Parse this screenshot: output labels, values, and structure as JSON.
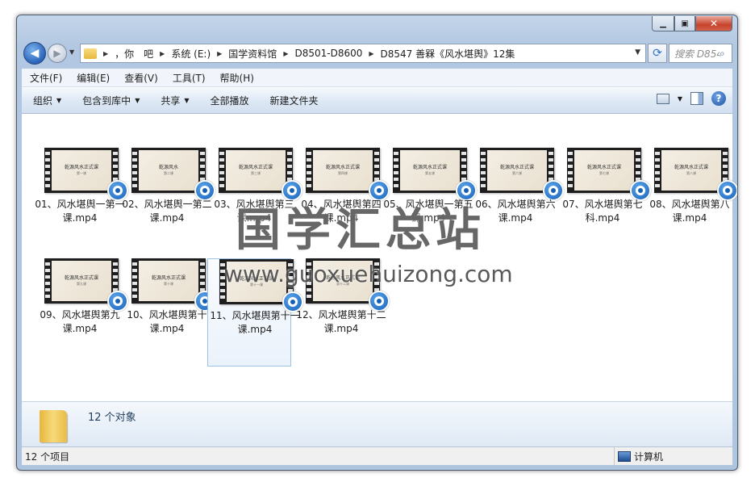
{
  "window": {
    "min_label": "▁",
    "max_label": "▣",
    "close_label": "✕"
  },
  "nav": {
    "back_label": "◀",
    "forward_label": "▶",
    "breadcrumb": [
      "，你　吧",
      "系统 (E:)",
      "国学资料馆",
      "D8501-D8600",
      "D8547 善槑《风水堪舆》12集"
    ],
    "search_placeholder": "搜索 D854...",
    "search_icon": "magnifier-icon",
    "refresh_label": "⟳"
  },
  "menu": [
    "文件(F)",
    "编辑(E)",
    "查看(V)",
    "工具(T)",
    "帮助(H)"
  ],
  "toolbar": {
    "organize": "组织",
    "include_library": "包含到库中",
    "share": "共享",
    "play_all": "全部播放",
    "new_folder": "新建文件夹"
  },
  "files": [
    {
      "name": "01、风水堪舆一第一课.mp4",
      "thumb_title": "乾源风水正式课",
      "thumb_sub": "第一课"
    },
    {
      "name": "02、风水堪舆一第二课.mp4",
      "thumb_title": "乾源风水",
      "thumb_sub": "第二课"
    },
    {
      "name": "03、风水堪舆第三课.mp4",
      "thumb_title": "乾源风水正式课",
      "thumb_sub": "第三课"
    },
    {
      "name": "04、风水堪舆第四课.mp4",
      "thumb_title": "乾源风水正式课",
      "thumb_sub": "第四课"
    },
    {
      "name": "05、风水堪舆一第五课.mp4",
      "thumb_title": "乾源风水正式课",
      "thumb_sub": "第五课"
    },
    {
      "name": "06、风水堪舆第六课.mp4",
      "thumb_title": "乾源风水正式课",
      "thumb_sub": "第六课"
    },
    {
      "name": "07、风水堪舆第七科.mp4",
      "thumb_title": "乾源风水正式课",
      "thumb_sub": "第七课"
    },
    {
      "name": "08、风水堪舆第八课.mp4",
      "thumb_title": "乾源风水正式课",
      "thumb_sub": "第八课"
    },
    {
      "name": "09、风水堪舆第九课.mp4",
      "thumb_title": "乾源风水正式课",
      "thumb_sub": "第九课"
    },
    {
      "name": "10、风水堪舆第十课.mp4",
      "thumb_title": "乾源风水正式课",
      "thumb_sub": "第十课"
    },
    {
      "name": "11、风水堪舆第十一课.mp4",
      "thumb_title": "乾源风水正式课",
      "thumb_sub": "第十一课"
    },
    {
      "name": "12、风水堪舆第十二课.mp4",
      "thumb_title": "乾源风水正式课",
      "thumb_sub": "第十二课"
    }
  ],
  "details": {
    "count": "12 个对象"
  },
  "status": {
    "items": "12 个项目",
    "location": "计算机"
  },
  "watermark": {
    "cn": "国学汇总站",
    "url": "www.guoxuehuizong.com"
  }
}
